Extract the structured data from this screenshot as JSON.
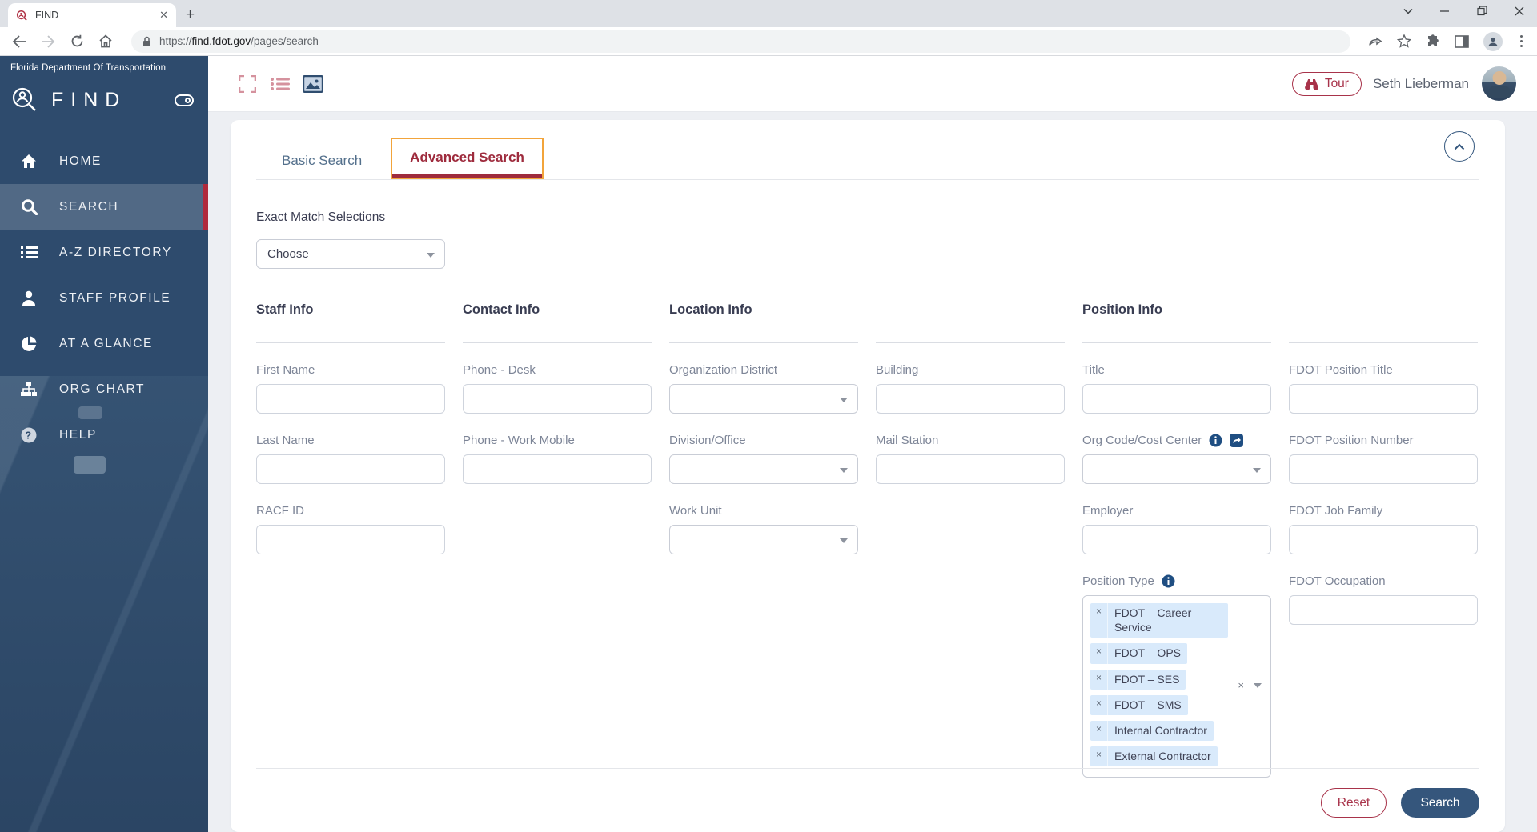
{
  "browser": {
    "tab_title": "FIND",
    "url_protocol": "https://",
    "url_domain": "find.fdot.gov",
    "url_path": "/pages/search"
  },
  "sidebar": {
    "org_name": "Florida Department Of Transportation",
    "app_name": "FIND",
    "items": [
      {
        "label": "HOME",
        "icon": "home-icon"
      },
      {
        "label": "SEARCH",
        "icon": "search-icon"
      },
      {
        "label": "A-Z DIRECTORY",
        "icon": "list-icon"
      },
      {
        "label": "STAFF PROFILE",
        "icon": "person-icon"
      },
      {
        "label": "AT A GLANCE",
        "icon": "pie-chart-icon"
      },
      {
        "label": "ORG CHART",
        "icon": "org-chart-icon"
      },
      {
        "label": "HELP",
        "icon": "help-icon"
      }
    ]
  },
  "header": {
    "tour_label": "Tour",
    "user_name": "Seth Lieberman"
  },
  "search_panel": {
    "tabs": {
      "basic": "Basic Search",
      "advanced": "Advanced Search"
    },
    "exact_match_label": "Exact Match Selections",
    "choose_placeholder": "Choose",
    "sections": {
      "staff_title": "Staff Info",
      "contact_title": "Contact Info",
      "location_title": "Location Info",
      "position_title": "Position Info"
    },
    "labels": {
      "first_name": "First Name",
      "last_name": "Last Name",
      "racf_id": "RACF ID",
      "phone_desk": "Phone - Desk",
      "phone_mobile": "Phone - Work Mobile",
      "org_district": "Organization District",
      "division_office": "Division/Office",
      "work_unit": "Work Unit",
      "building": "Building",
      "mail_station": "Mail Station",
      "title": "Title",
      "org_code": "Org Code/Cost Center",
      "employer": "Employer",
      "position_type": "Position Type",
      "fdot_position_title": "FDOT Position Title",
      "fdot_position_number": "FDOT Position Number",
      "fdot_job_family": "FDOT Job Family",
      "fdot_occupation": "FDOT Occupation"
    },
    "position_type_chips": [
      "FDOT – Career Service",
      "FDOT – OPS",
      "FDOT – SES",
      "FDOT – SMS",
      "Internal Contractor",
      "External Contractor"
    ],
    "buttons": {
      "reset": "Reset",
      "search": "Search"
    }
  },
  "colors": {
    "accent_red": "#A8334A",
    "sidebar_navy": "#2E4B6D",
    "primary_blue": "#35567C",
    "chip_blue": "#D9EAFB",
    "tab_focus_orange": "#F2A43B"
  }
}
